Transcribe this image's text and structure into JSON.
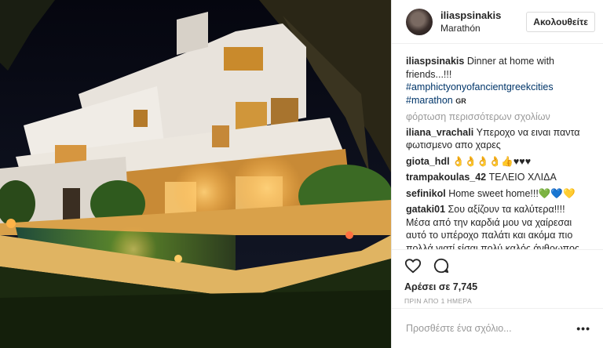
{
  "header": {
    "username": "iliaspsinakis",
    "location": "Marathón",
    "follow_label": "Ακολουθείτε"
  },
  "caption": {
    "username": "iliaspsinakis",
    "text": "Dinner at home with friends...!!!",
    "hashtags": [
      "#amphictyonyofancientgreekcities",
      "#marathon"
    ],
    "badge": "GR"
  },
  "load_more": "φόρτωση περισσότερων σχολίων",
  "comments": [
    {
      "user": "iliana_vrachali",
      "text": "Υπεροχο να ειναι παντα φωτισμενο απο χαρες"
    },
    {
      "user": "giota_hdl",
      "text": "👌👌👌👌👍♥♥♥"
    },
    {
      "user": "trampakoulas_42",
      "text": "ΤΕΛΕΙΟ ΧΛΙΔΑ"
    },
    {
      "user": "sefinikol",
      "text": "Home sweet home!!!💚💙💛"
    },
    {
      "user": "gataki01",
      "text": "Σου αξίζουν τα καλύτερα!!!! Μέσα από την καρδιά μου να χαίρεσαι αυτό το υπέροχο παλάτι και ακόμα πιο πολλά γιατί είσαι πολύ καλός άνθρωπος και σου αξίζουν"
    }
  ],
  "actions": {
    "like_icon": "heart-icon",
    "comment_icon": "comment-icon",
    "likes_text": "Αρέσει σε 7,745",
    "time_text": "ΠΡΙΝ ΑΠΟ 1 ΗΜΕΡΑ"
  },
  "add_comment": {
    "placeholder": "Προσθέστε ένα σχόλιο...",
    "more_label": "•••"
  },
  "colors": {
    "hashtag": "#003569",
    "muted": "#999999",
    "text": "#262626"
  }
}
